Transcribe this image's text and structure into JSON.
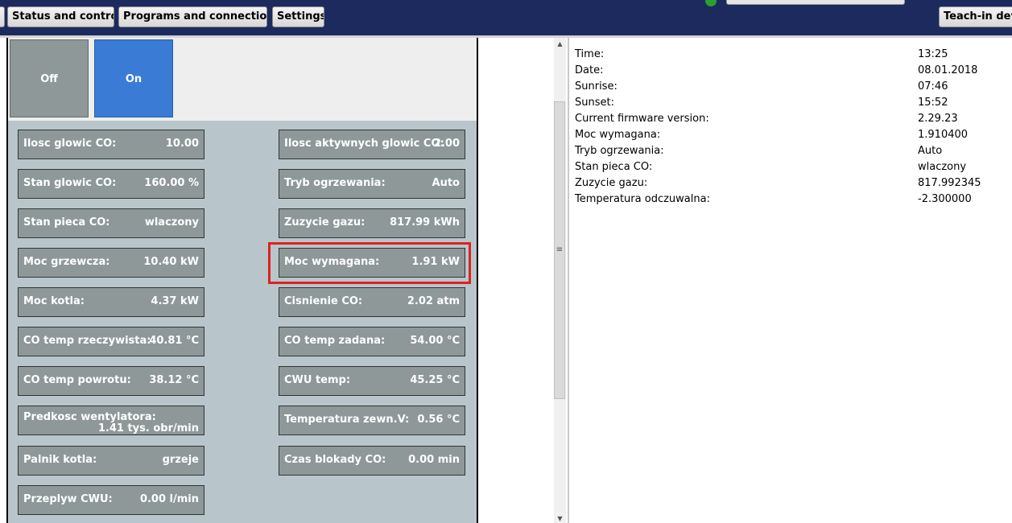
{
  "nav": {
    "status_control": "Status and control",
    "programs_connections": "Programs and connections",
    "settings": "Settings",
    "teach_in": "Teach-in dev"
  },
  "toggles": {
    "off": "Off",
    "on": "On",
    "selected": "On"
  },
  "tiles_left": [
    {
      "label": "Ilosc glowic CO:",
      "value": "10.00"
    },
    {
      "label": "Stan glowic CO:",
      "value": "160.00 %"
    },
    {
      "label": "Stan pieca CO:",
      "value": "wlaczony"
    },
    {
      "label": "Moc grzewcza:",
      "value": "10.40 kW"
    },
    {
      "label": "Moc kotla:",
      "value": "4.37 kW"
    },
    {
      "label": "CO temp rzeczywista:",
      "value": "40.81 °C"
    },
    {
      "label": "CO temp powrotu:",
      "value": "38.12 °C"
    },
    {
      "label": "Predkosc wentylatora:",
      "value": "1.41 tys. obr/min"
    },
    {
      "label": "Palnik kotla:",
      "value": "grzeje"
    },
    {
      "label": "Przeplyw CWU:",
      "value": "0.00 l/min"
    }
  ],
  "tiles_right": [
    {
      "label": "Ilosc aktywnych glowic CO:",
      "value": "2.00"
    },
    {
      "label": "Tryb ogrzewania:",
      "value": "Auto"
    },
    {
      "label": "Zuzycie gazu:",
      "value": "817.99 kWh"
    },
    {
      "label": "Moc wymagana:",
      "value": "1.91 kW"
    },
    {
      "label": "Cisnienie CO:",
      "value": "2.02 atm"
    },
    {
      "label": "CO temp zadana:",
      "value": "54.00 °C"
    },
    {
      "label": "CWU temp:",
      "value": "45.25 °C"
    },
    {
      "label": "Temperatura zewn.V:",
      "value": "0.56 °C"
    },
    {
      "label": "Czas blokady CO:",
      "value": "0.00 min"
    }
  ],
  "info": [
    {
      "key": "Time:",
      "value": "13:25"
    },
    {
      "key": "Date:",
      "value": "08.01.2018"
    },
    {
      "key": "Sunrise:",
      "value": "07:46"
    },
    {
      "key": "Sunset:",
      "value": "15:52"
    },
    {
      "key": "Current firmware version:",
      "value": "2.29.23"
    },
    {
      "key": "Moc wymagana:",
      "value": "1.910400"
    },
    {
      "key": "Tryb ogrzewania:",
      "value": "Auto"
    },
    {
      "key": "Stan pieca CO:",
      "value": "wlaczony"
    },
    {
      "key": "Zuzycie gazu:",
      "value": "817.992345"
    },
    {
      "key": "Temperatura odczuwalna:",
      "value": "-2.300000"
    }
  ],
  "scrollbar": {
    "arrow_up": "▲",
    "arrow_down": "▼",
    "grip": "≡"
  },
  "colors": {
    "topbar": "#1c2a5e",
    "tile": "#8e9898",
    "toggle_on": "#3a7bd5",
    "highlight": "#e02020",
    "status_dot": "#2ca02c"
  }
}
